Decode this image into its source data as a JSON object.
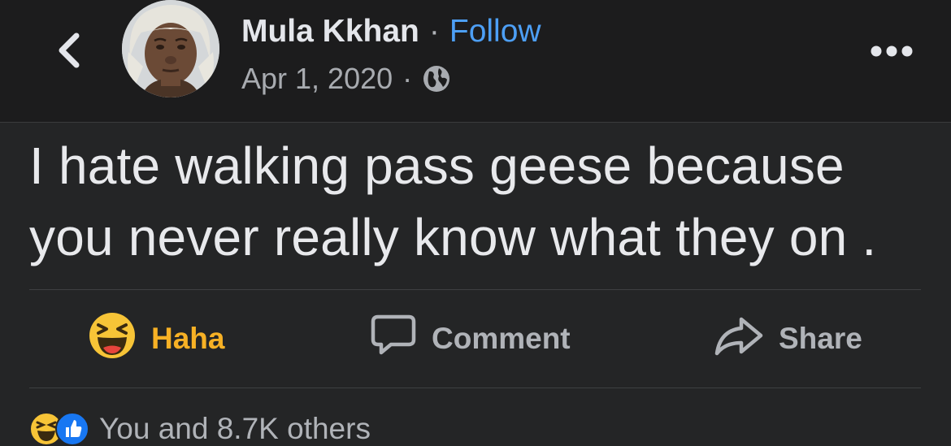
{
  "post": {
    "author": "Mula Kkhan",
    "separator": "·",
    "follow_label": "Follow",
    "date": "Apr 1, 2020",
    "audience_icon": "globe-icon",
    "text_lines": [
      "I hate walking pass geese because",
      "you never really know what they on ."
    ]
  },
  "actions": {
    "haha_label": "Haha",
    "comment_label": "Comment",
    "share_label": "Share"
  },
  "reactions": {
    "summary": "You and 8.7K others",
    "icons": [
      "haha-reaction-icon",
      "like-reaction-icon"
    ]
  },
  "colors": {
    "background": "#242526",
    "header_background": "#1c1c1d",
    "follow_blue": "#4d9ff5",
    "haha_yellow": "#f7b125",
    "text_primary": "#e4e6eb",
    "text_secondary": "#b0b3b8"
  }
}
